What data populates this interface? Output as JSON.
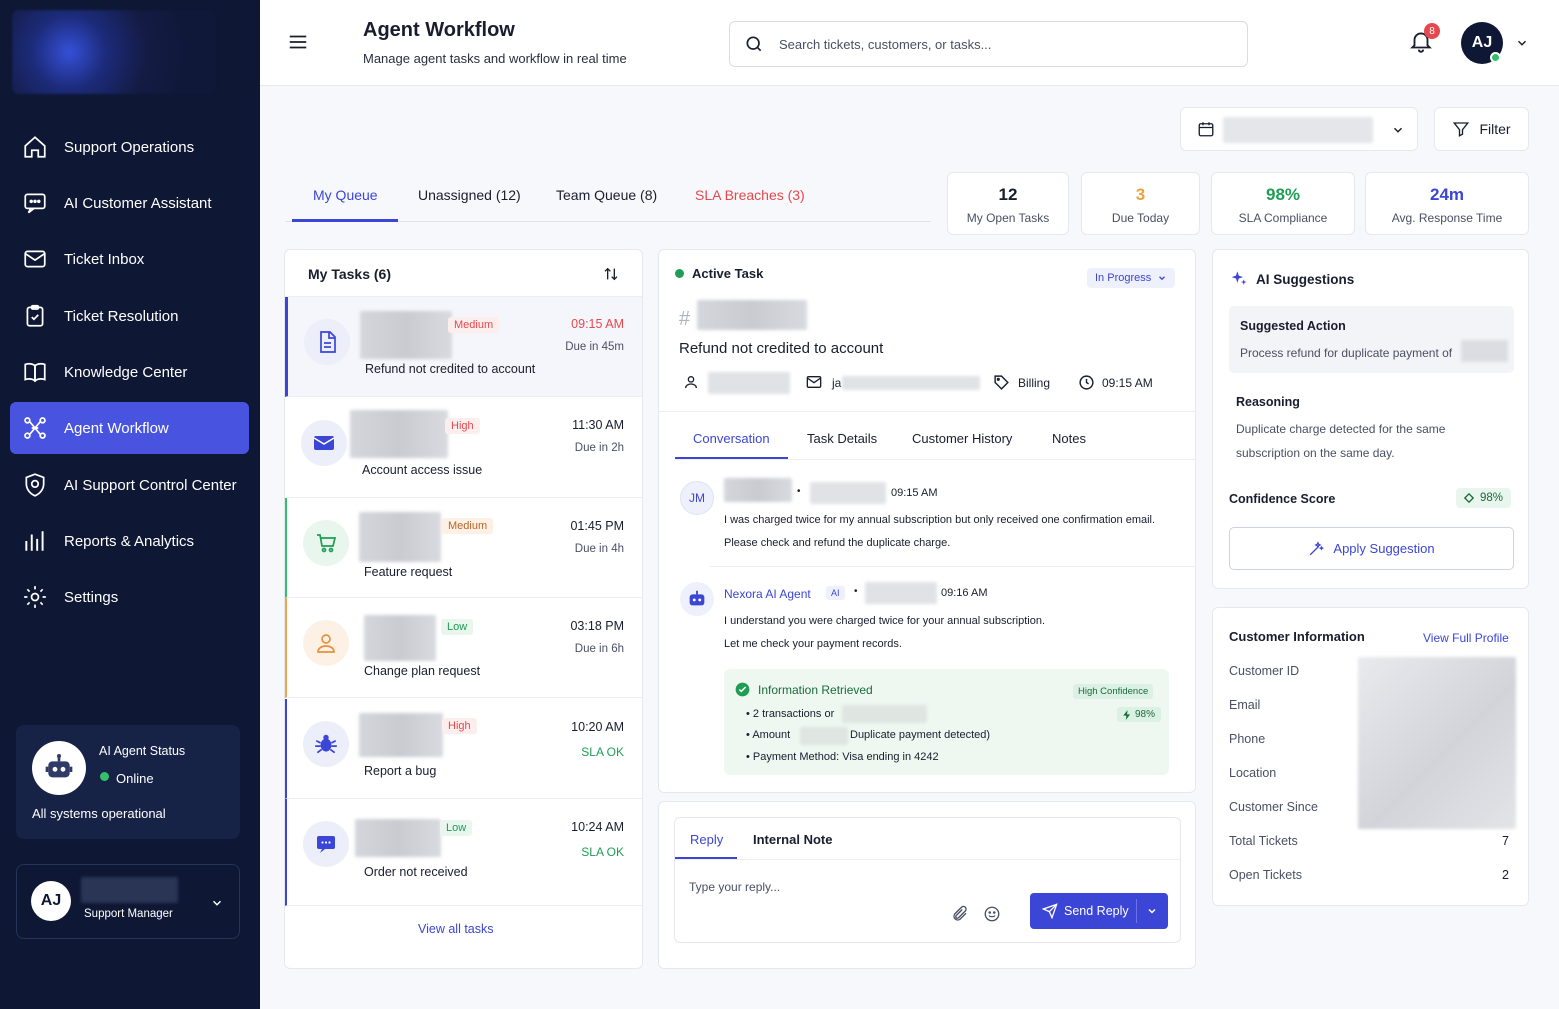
{
  "app": {
    "title": "Agent Workflow",
    "subtitle": "Manage agent tasks and workflow in real time"
  },
  "search": {
    "placeholder": "Search tickets, customers, or tasks..."
  },
  "notifications": {
    "count": "8"
  },
  "user": {
    "initials": "AJ",
    "role": "Support Manager"
  },
  "sidebar": {
    "items": [
      {
        "label": "Support Operations",
        "icon": "home-icon"
      },
      {
        "label": "AI Customer Assistant",
        "icon": "chat-icon"
      },
      {
        "label": "Ticket Inbox",
        "icon": "mail-icon"
      },
      {
        "label": "Ticket Resolution",
        "icon": "clipboard-check-icon"
      },
      {
        "label": "Knowledge Center",
        "icon": "book-icon"
      },
      {
        "label": "Agent Workflow",
        "icon": "workflow-icon"
      },
      {
        "label": "AI Support Control Center",
        "icon": "shield-icon"
      },
      {
        "label": "Reports & Analytics",
        "icon": "bar-chart-icon"
      },
      {
        "label": "Settings",
        "icon": "gear-icon"
      }
    ],
    "status": {
      "title": "AI Agent Status",
      "state": "Online",
      "message": "All systems operational"
    }
  },
  "toolbar": {
    "filter_label": "Filter"
  },
  "tabs": [
    {
      "label": "My Queue"
    },
    {
      "label": "Unassigned (12)"
    },
    {
      "label": "Team Queue (8)"
    },
    {
      "label": "SLA Breaches (3)"
    }
  ],
  "stats": [
    {
      "value": "12",
      "label": "My Open Tasks",
      "color": "#1a1d2e"
    },
    {
      "value": "3",
      "label": "Due Today",
      "color": "#e8a33d"
    },
    {
      "value": "98%",
      "label": "SLA Compliance",
      "color": "#1f9d55"
    },
    {
      "value": "24m",
      "label": "Avg. Response Time",
      "color": "#3b45d6"
    }
  ],
  "tasks_panel": {
    "title": "My Tasks (6)",
    "view_all": "View all tasks",
    "tasks": [
      {
        "badge": "Medium",
        "time": "09:15 AM",
        "due": "Due in 45m",
        "title": "Refund not credited to account",
        "icon": "document-icon"
      },
      {
        "badge": "High",
        "time": "11:30 AM",
        "due": "Due in 2h",
        "title": "Account access issue",
        "icon": "envelope-icon"
      },
      {
        "badge": "Medium",
        "time": "01:45 PM",
        "due": "Due in 4h",
        "title": "Feature request",
        "icon": "cart-icon"
      },
      {
        "badge": "Low",
        "time": "03:18 PM",
        "due": "Due in 6h",
        "title": "Change plan request",
        "icon": "user-icon"
      },
      {
        "badge": "High",
        "time": "10:20 AM",
        "due": "SLA OK",
        "title": "Report a bug",
        "icon": "bug-icon"
      },
      {
        "badge": "Low",
        "time": "10:24 AM",
        "due": "SLA OK",
        "title": "Order not received",
        "icon": "chat-bubble-icon"
      }
    ]
  },
  "active_task": {
    "header": "Active Task",
    "status": "In Progress",
    "id_prefix": "#",
    "title": "Refund not credited to account",
    "category": "Billing",
    "time": "09:15 AM",
    "email_prefix": "ja",
    "tabs": [
      "Conversation",
      "Task Details",
      "Customer History",
      "Notes"
    ],
    "messages": [
      {
        "initials": "JM",
        "time": "09:15 AM",
        "text1": "I was charged twice for my annual subscription but only received one confirmation email.",
        "text2": "Please check and refund the duplicate charge."
      },
      {
        "name": "Nexora AI Agent",
        "tag": "AI",
        "time": "09:16 AM",
        "text1": "I understand you were charged twice for your annual subscription.",
        "text2": "Let me check your payment records."
      }
    ],
    "info": {
      "title": "Information Retrieved",
      "confidence_label": "High Confidence",
      "confidence": "98%",
      "line1": "2 transactions or",
      "line2_pre": "Amount",
      "line2_post": "Duplicate payment detected)",
      "line3": "Payment Method: Visa ending in 4242"
    },
    "reply": {
      "tabs": [
        "Reply",
        "Internal Note"
      ],
      "placeholder": "Type your reply...",
      "send": "Send Reply"
    }
  },
  "ai": {
    "title": "AI Suggestions",
    "action_title": "Suggested Action",
    "action_text": "Process refund for duplicate payment of",
    "reason_title": "Reasoning",
    "reason_text1": "Duplicate charge detected for the same",
    "reason_text2": "subscription on the same day.",
    "confidence_label": "Confidence Score",
    "confidence": "98%",
    "apply": "Apply Suggestion"
  },
  "customer": {
    "title": "Customer Information",
    "link": "View Full Profile",
    "fields": [
      {
        "label": "Customer ID",
        "value": ""
      },
      {
        "label": "Email",
        "value": ""
      },
      {
        "label": "Phone",
        "value": ""
      },
      {
        "label": "Location",
        "value": ""
      },
      {
        "label": "Customer Since",
        "value": ""
      },
      {
        "label": "Total Tickets",
        "value": "7"
      },
      {
        "label": "Open Tickets",
        "value": "2"
      }
    ]
  }
}
